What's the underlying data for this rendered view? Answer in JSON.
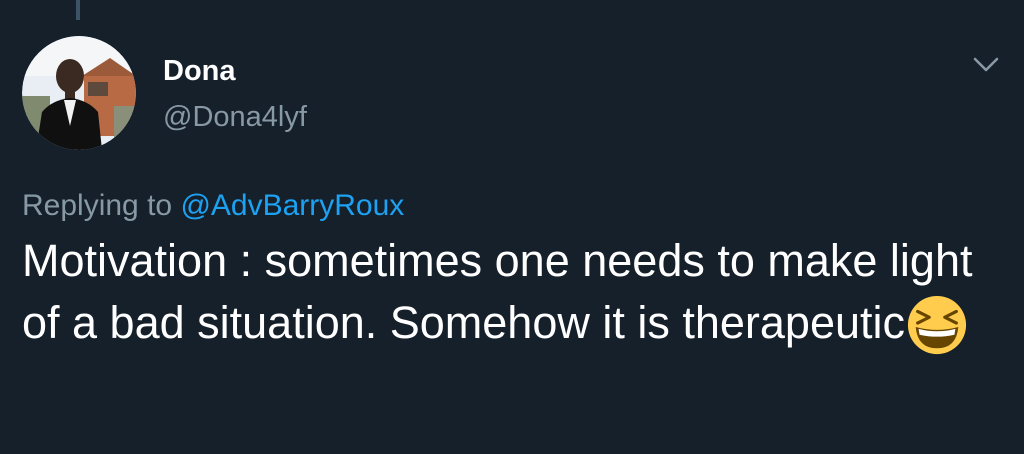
{
  "tweet": {
    "author": {
      "display_name": "Dona",
      "handle": "@Dona4lyf",
      "avatar_icon": "profile-photo"
    },
    "menu_icon": "chevron-down-icon",
    "reply": {
      "prefix": "Replying to ",
      "mention": "@AdvBarryRoux"
    },
    "text": "Motivation : sometimes one needs to make light of a bad situation. Somehow it is therapeutic",
    "emoji": "grinning-squinting-face",
    "emoji_char": "😆"
  },
  "colors": {
    "background": "#15202b",
    "primary_text": "#ffffff",
    "secondary_text": "#8899a6",
    "link": "#1da1f2",
    "thread_line": "#3d5466"
  }
}
